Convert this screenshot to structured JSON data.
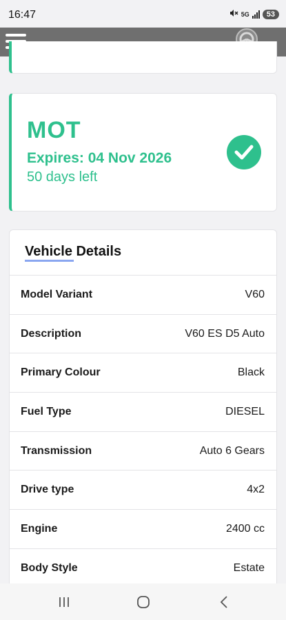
{
  "status_bar": {
    "time": "16:47",
    "network": "5G",
    "battery": "53"
  },
  "icons": {
    "menu": "hamburger-menu-icon",
    "logo": "steering-wheel-logo-icon",
    "check": "check-circle-icon",
    "recents": "recents-icon",
    "home": "home-icon",
    "back": "back-icon",
    "mute": "mute-icon",
    "signal": "signal-icon"
  },
  "colors": {
    "accent_green": "#2ec08d",
    "app_bar": "#6f6f6f",
    "underline": "#8aa6f0"
  },
  "mot": {
    "title": "MOT",
    "expires": "Expires: 04 Nov 2026",
    "days_left": "50 days left"
  },
  "vehicle_details": {
    "title": "Vehicle Details",
    "rows": [
      {
        "label": "Model Variant",
        "value": "V60"
      },
      {
        "label": "Description",
        "value": "V60 ES D5 Auto"
      },
      {
        "label": "Primary Colour",
        "value": "Black"
      },
      {
        "label": "Fuel Type",
        "value": "DIESEL"
      },
      {
        "label": "Transmission",
        "value": "Auto 6 Gears"
      },
      {
        "label": "Drive type",
        "value": "4x2"
      },
      {
        "label": "Engine",
        "value": "2400 cc"
      },
      {
        "label": "Body Style",
        "value": "Estate"
      }
    ]
  }
}
